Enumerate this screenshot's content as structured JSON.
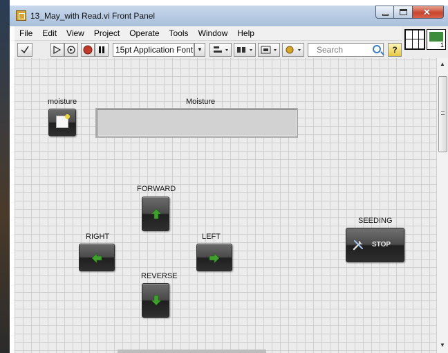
{
  "window": {
    "title": "13_May_with Read.vi Front Panel",
    "close_glyph": "✕"
  },
  "menu": [
    "File",
    "Edit",
    "View",
    "Project",
    "Operate",
    "Tools",
    "Window",
    "Help"
  ],
  "toolbar": {
    "font_select": "15pt Application Font",
    "search_placeholder": "Search",
    "help_glyph": "?"
  },
  "panel": {
    "moisture_button_label": "moisture",
    "moisture_indicator_label": "Moisture",
    "moisture_indicator_value": "",
    "forward_label": "FORWARD",
    "right_label": "RIGHT",
    "left_label": "LEFT",
    "reverse_label": "REVERSE",
    "seeding_label": "SEEDING",
    "stop_label": "STOP"
  },
  "colors": {
    "arrow_green": "#3fa02d",
    "panel_bg": "#ececec",
    "grid": "#cfcfcf"
  },
  "icons": {
    "forward": "arrow-up-icon",
    "reverse": "arrow-down-icon",
    "right": "arrow-left-icon",
    "left": "arrow-right-icon",
    "seeding": "tools-icon"
  }
}
